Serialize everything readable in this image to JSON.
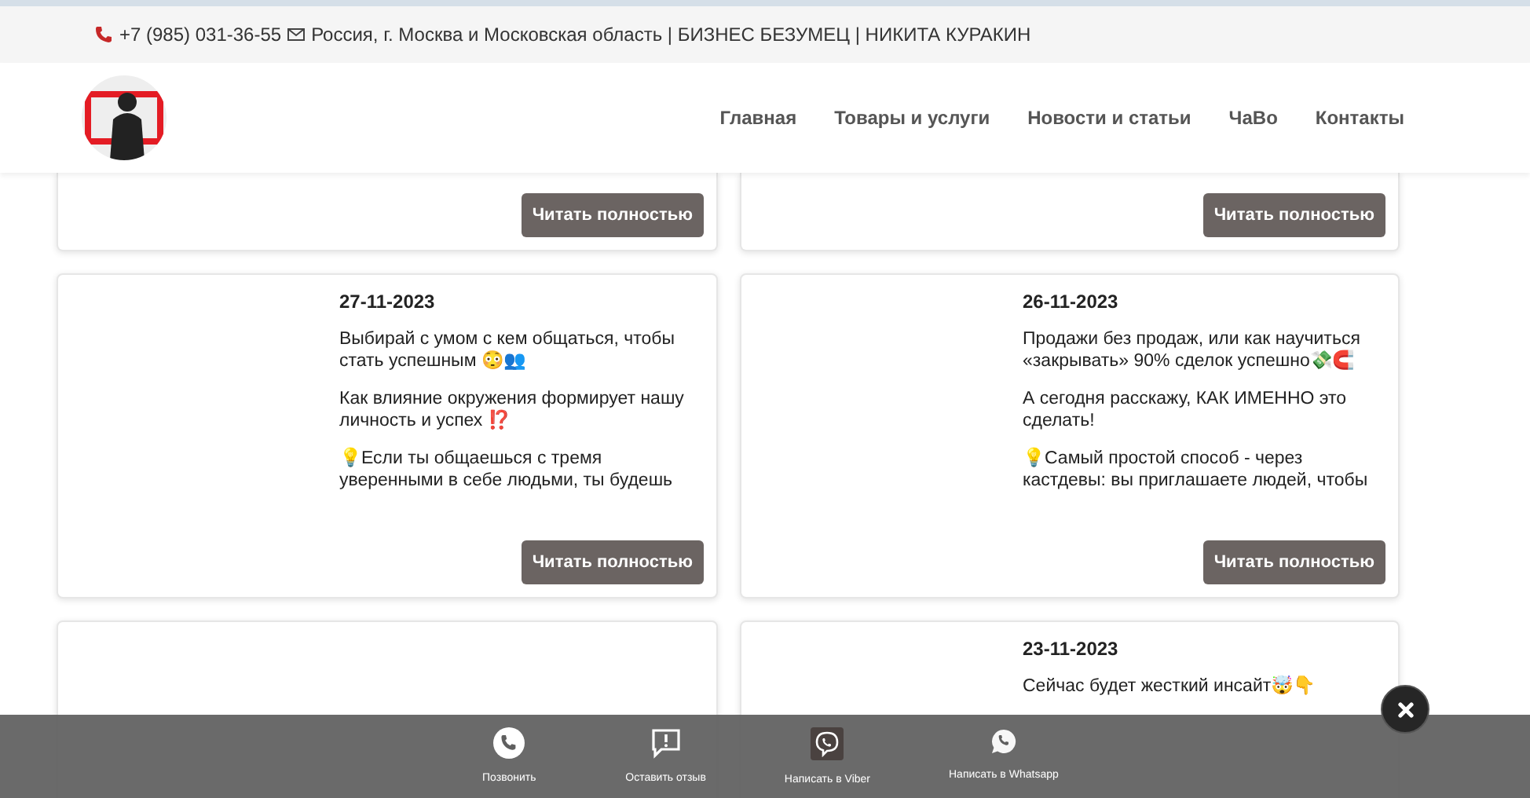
{
  "topbar": {
    "phone": "+7 (985) 031-36-55",
    "address": "Россия, г. Москва и Московская область | БИЗНЕС БЕЗУМЕЦ | НИКИТА КУРАКИН"
  },
  "nav": [
    {
      "label": "Главная"
    },
    {
      "label": "Товары и услуги"
    },
    {
      "label": "Новости и статьи"
    },
    {
      "label": "ЧаВо"
    },
    {
      "label": "Контакты"
    }
  ],
  "posts": [
    {
      "kind": "tail",
      "button": "Читать полностью"
    },
    {
      "kind": "tail",
      "button": "Читать полностью"
    },
    {
      "kind": "full",
      "date": "27-11-2023",
      "paragraphs": [
        "Выбирай с умом с кем общаться, чтобы стать успешным 😳👥",
        "Как влияние окружения формирует нашу личность и успех ⁉️",
        "💡Если ты общаешься с тремя уверенными в себе людьми, ты будешь"
      ],
      "button": "Читать полностью"
    },
    {
      "kind": "full",
      "date": "26-11-2023",
      "paragraphs": [
        "Продажи без продаж, или как научиться «закрывать» 90% сделок успешно💸🧲",
        "А сегодня расскажу, КАК ИМЕННО это сделать!",
        "💡Самый простой способ - через кастдевы: вы приглашаете людей, чтобы"
      ],
      "button": "Читать полностью"
    },
    {
      "kind": "head"
    },
    {
      "kind": "head",
      "date": "23-11-2023",
      "paragraphs": [
        "Сейчас будет жесткий инсайт🤯👇"
      ]
    }
  ],
  "contact_bar": [
    {
      "kind": "call",
      "label": "Позвонить"
    },
    {
      "kind": "review",
      "label": "Оставить отзыв"
    },
    {
      "kind": "viber",
      "label": "Написать в Viber"
    },
    {
      "kind": "whatsapp",
      "label": "Написать в Whatsapp"
    }
  ]
}
